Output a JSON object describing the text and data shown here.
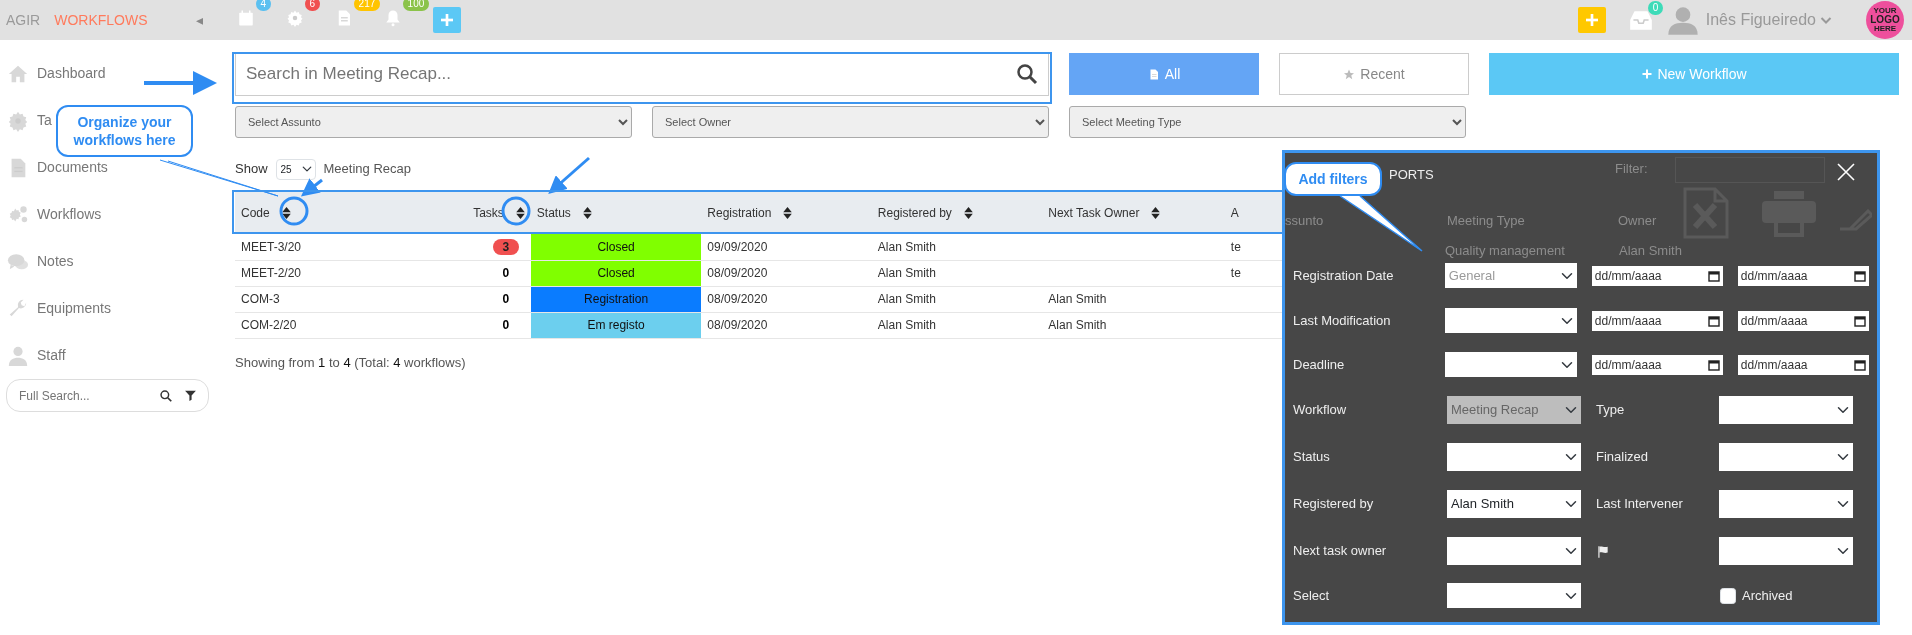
{
  "topbar": {
    "brand": "AGIR",
    "app": "WORKFLOWS",
    "collapse_glyph": "◂",
    "notifications": [
      {
        "kind": "calendar",
        "count": "4",
        "color": "#5bc0f0"
      },
      {
        "kind": "gear",
        "count": "6",
        "color": "#f05050"
      },
      {
        "kind": "document",
        "count": "217",
        "color": "#ffc400"
      },
      {
        "kind": "bell",
        "count": "100",
        "color": "#8bc34a"
      }
    ],
    "inbox_count": "0",
    "user": "Inês Figueiredo",
    "logo": [
      "YOUR",
      "LOGO",
      "HERE"
    ]
  },
  "sidebar": {
    "items": [
      {
        "label": "Dashboard"
      },
      {
        "label": "Ta"
      },
      {
        "label": "Documents"
      },
      {
        "label": "Workflows"
      },
      {
        "label": "Notes"
      },
      {
        "label": "Equipments"
      },
      {
        "label": "Staff"
      }
    ],
    "search": {
      "placeholder": "Full Search..."
    }
  },
  "search": {
    "placeholder": "Search in Meeting Recap..."
  },
  "filter_buttons": [
    {
      "label": "All",
      "selected": true
    },
    {
      "label": "Recent",
      "selected": false
    }
  ],
  "new_button": "New Workflow",
  "selects": [
    {
      "placeholder": "Select Assunto"
    },
    {
      "placeholder": "Select Owner"
    },
    {
      "placeholder": "Select Meeting Type"
    }
  ],
  "list_header": {
    "show": "Show",
    "page_size": "25",
    "title": "Meeting Recap"
  },
  "table": {
    "columns": [
      {
        "label": "Code",
        "sortable": true
      },
      {
        "label": "Tasks",
        "sortable": true
      },
      {
        "label": "Status",
        "sortable": true
      },
      {
        "label": "Registration",
        "sortable": true
      },
      {
        "label": "Registered by",
        "sortable": true
      },
      {
        "label": "Next Task Owner",
        "sortable": true
      },
      {
        "label": "A",
        "sortable": false
      }
    ],
    "rows": [
      {
        "code": "MEET-3/20",
        "tasks": "3",
        "tasks_alert": true,
        "status": "Closed",
        "color": "#80ff00",
        "registration": "09/09/2020",
        "registered_by": "Alan Smith",
        "next_owner": "",
        "column_7": "te"
      },
      {
        "code": "MEET-2/20",
        "tasks": "0",
        "tasks_alert": false,
        "status": "Closed",
        "color": "#80ff00",
        "registration": "08/09/2020",
        "registered_by": "Alan Smith",
        "next_owner": "",
        "column_7": "te"
      },
      {
        "code": "COM-3",
        "tasks": "0",
        "tasks_alert": false,
        "status": "Registration",
        "color": "#0a7cff",
        "registration": "08/09/2020",
        "registered_by": "Alan Smith",
        "next_owner": "Alan Smith",
        "column_7": ""
      },
      {
        "code": "COM-2/20",
        "tasks": "0",
        "tasks_alert": false,
        "status": "Em registo",
        "color": "#6ccfee",
        "registration": "08/09/2020",
        "registered_by": "Alan Smith",
        "next_owner": "Alan Smith",
        "column_7": ""
      }
    ]
  },
  "summary": "Showing from **1** to **4** (Total: **4** workflows)",
  "filter_panel": {
    "title": "PORTS",
    "background_texts": [
      "Filter:",
      "ssunto",
      "Meeting Type",
      "Owner",
      "Quality management",
      "Alan Smith"
    ],
    "rows": [
      {
        "kind": "dates",
        "label": "Registration Date",
        "value": "General",
        "from": "dd/mm/aaaa",
        "to": "dd/mm/aaaa"
      },
      {
        "kind": "dates",
        "label": "Last Modification",
        "from": "dd/mm/aaaa",
        "to": "dd/mm/aaaa"
      },
      {
        "kind": "dates",
        "label": "Deadline",
        "from": "dd/mm/aaaa",
        "to": "dd/mm/aaaa"
      },
      {
        "kind": "pair",
        "label": "Workflow",
        "value": "Meeting Recap",
        "disabled": true,
        "second_label": "Type"
      },
      {
        "kind": "pair",
        "label": "Status",
        "disabled": false,
        "second_label": "Finalized"
      },
      {
        "kind": "pair",
        "label": "Registered by",
        "value": "Alan Smith",
        "disabled": false,
        "second_label": "Last Intervener"
      },
      {
        "kind": "flag_pair",
        "label": "Next task owner",
        "disabled": false
      },
      {
        "kind": "check",
        "label": "Select",
        "check_label": "Archived",
        "checked": false
      }
    ]
  },
  "annotations": [
    {
      "kind": "organize",
      "text": "Organize your workflows here"
    },
    {
      "kind": "filters",
      "text": "Add filters"
    }
  ]
}
